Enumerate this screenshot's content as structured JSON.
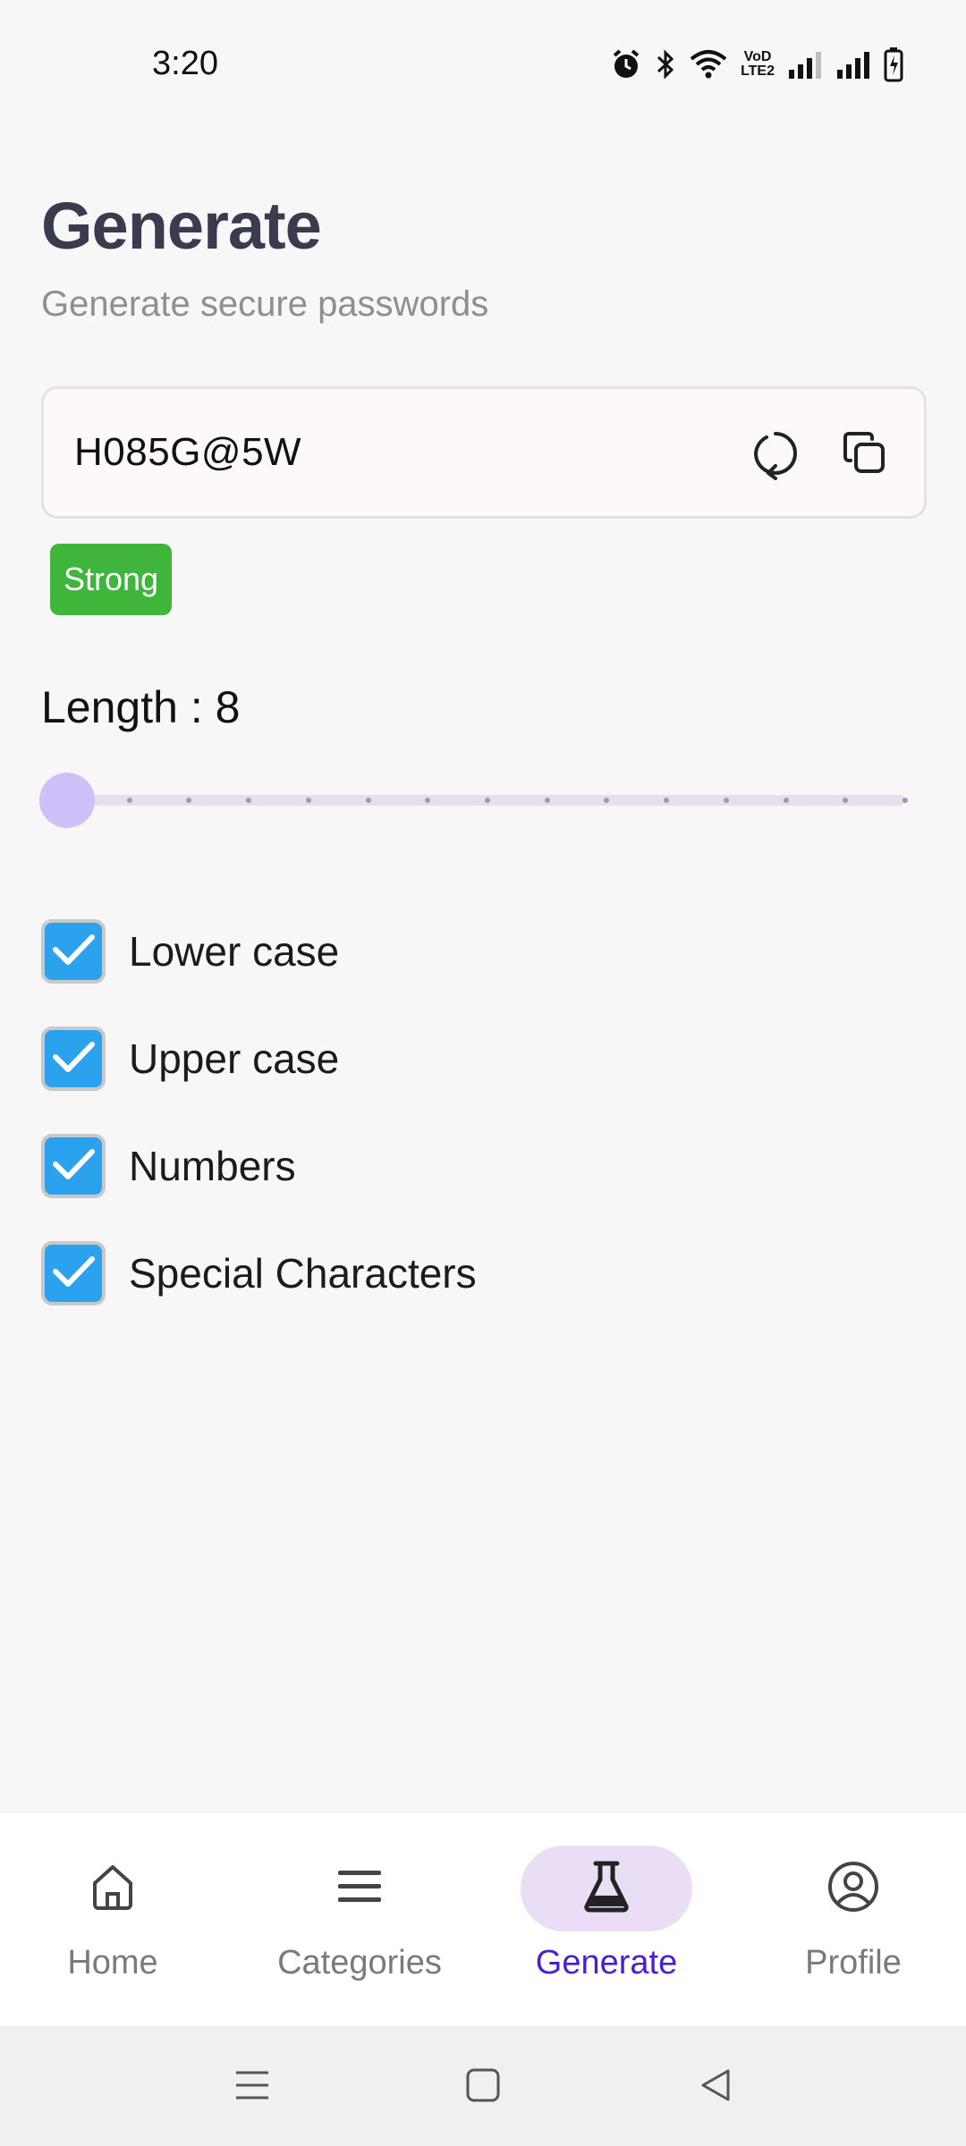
{
  "status_bar": {
    "time": "3:20",
    "network_label_top": "VoD",
    "network_label_bottom": "LTE2"
  },
  "header": {
    "title": "Generate",
    "subtitle": "Generate secure passwords"
  },
  "password": {
    "value": "H085G@5W",
    "strength": "Strong",
    "strength_color": "#3fb53b",
    "refresh_icon": "refresh-icon",
    "copy_icon": "copy-icon"
  },
  "length": {
    "label": "Length : 8",
    "value": 8,
    "min": 8,
    "max": 22,
    "step": 1
  },
  "options": [
    {
      "label": "Lower case",
      "checked": true
    },
    {
      "label": "Upper case",
      "checked": true
    },
    {
      "label": "Numbers",
      "checked": true
    },
    {
      "label": "Special Characters",
      "checked": true
    }
  ],
  "bottom_nav": {
    "items": [
      {
        "label": "Home",
        "icon": "home-icon",
        "active": false
      },
      {
        "label": "Categories",
        "icon": "menu-icon",
        "active": false
      },
      {
        "label": "Generate",
        "icon": "flask-icon",
        "active": true
      },
      {
        "label": "Profile",
        "icon": "profile-icon",
        "active": false
      }
    ],
    "active_color": "#4b1fd1",
    "active_pill_color": "#e9def6"
  },
  "colors": {
    "background": "#f7f7f7",
    "checkbox": "#2ba2ee",
    "slider_thumb": "#cfc0f9"
  }
}
